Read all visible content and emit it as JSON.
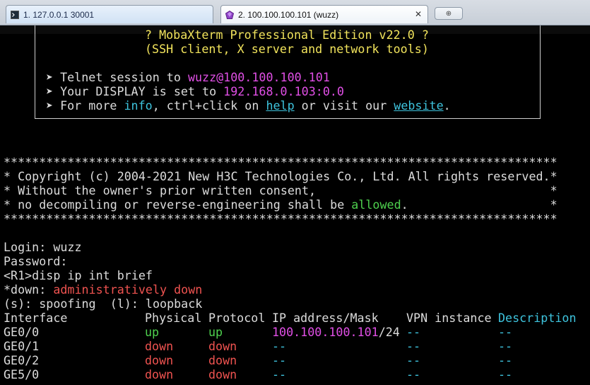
{
  "tabs": [
    {
      "label": "1. 127.0.0.1 30001",
      "close": ""
    },
    {
      "label": "2. 100.100.100.101 (wuzz)",
      "close": "✕"
    }
  ],
  "new_tab_label": "⊕",
  "banner": {
    "title": "? MobaXterm Professional Edition v22.0 ?",
    "subtitle": "(SSH client, X server and network tools)",
    "l1_prefix": "➤ Telnet session to ",
    "l1_value": "wuzz@100.100.100.101",
    "l2_prefix": "➤ Your DISPLAY is set to ",
    "l2_value": "192.168.0.103:0.0",
    "l3_a": "➤ For more ",
    "l3_info": "info",
    "l3_b": ", ctrl+click on ",
    "l3_help": "help",
    "l3_c": " or visit our ",
    "l3_website": "website",
    "l3_d": "."
  },
  "copyright": {
    "stars": "******************************************************************************",
    "l1": "* Copyright (c) 2004-2021 New H3C Technologies Co., Ltd. All rights reserved.*",
    "l2": "* Without the owner's prior written consent,                                 *",
    "l3_a": "* no decompiling or reverse-engineering shall be ",
    "l3_allowed": "allowed",
    "l3_b": ".                    *"
  },
  "session": {
    "login": "Login: wuzz",
    "password": "Password:",
    "command": "<R1>disp ip int brief",
    "down_a": "*down: ",
    "down_b": "administratively down",
    "spoofing": "(s): spoofing  (l): loopback"
  },
  "table": {
    "headers": {
      "interface": "Interface",
      "physical": "Physical",
      "protocol": "Protocol",
      "ip": "IP address/Mask",
      "vpn": "VPN instance",
      "desc": "Description"
    },
    "rows": [
      {
        "iface": "GE0/0",
        "phys": "up",
        "proto": "up",
        "ip": "100.100.100.101",
        "mask": "/24",
        "vpn": "--",
        "desc": "--"
      },
      {
        "iface": "GE0/1",
        "phys": "down",
        "proto": "down",
        "ip": "--",
        "mask": "",
        "vpn": "--",
        "desc": "--"
      },
      {
        "iface": "GE0/2",
        "phys": "down",
        "proto": "down",
        "ip": "--",
        "mask": "",
        "vpn": "--",
        "desc": "--"
      },
      {
        "iface": "GE5/0",
        "phys": "down",
        "proto": "down",
        "ip": "--",
        "mask": "",
        "vpn": "--",
        "desc": "--"
      }
    ]
  },
  "colors": {
    "yellow": "#f2e45c",
    "magenta": "#e14fe6",
    "cyan": "#3ec4de",
    "green": "#4ed14e",
    "red": "#ef5350"
  }
}
